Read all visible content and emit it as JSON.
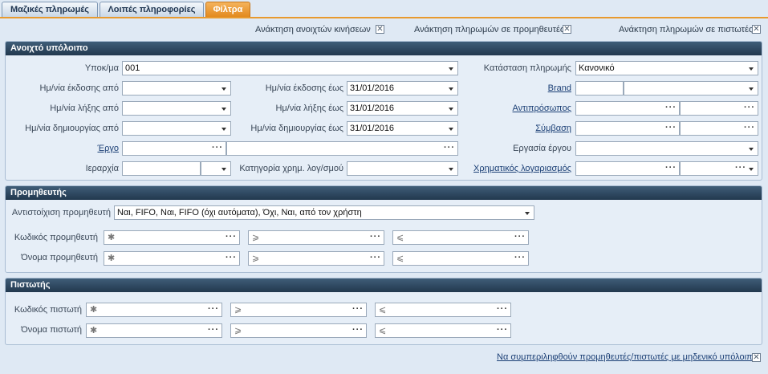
{
  "tabs": [
    {
      "label": "Μαζικές πληρωμές"
    },
    {
      "label": "Λοιπές πληροφορίες"
    },
    {
      "label": "Φίλτρα"
    }
  ],
  "top_options": [
    {
      "label": "Ανάκτηση ανοιχτών κινήσεων",
      "checked": "✕"
    },
    {
      "label": "Ανάκτηση πληρωμών σε προμηθευτές",
      "checked": "✕"
    },
    {
      "label": "Ανάκτηση πληρωμών σε πιστωτές",
      "checked": "✕"
    }
  ],
  "open_balance": {
    "title": "Ανοιχτό υπόλοιπο",
    "subsidiary_label": "Υποκ/μα",
    "subsidiary_value": "001",
    "issue_from_label": "Ημ/νία έκδοσης από",
    "issue_from_value": "",
    "issue_to_label": "Ημ/νία έκδοσης έως",
    "issue_to_value": "31/01/2016",
    "due_from_label": "Ημ/νία λήξης από",
    "due_from_value": "",
    "due_to_label": "Ημ/νία λήξης έως",
    "due_to_value": "31/01/2016",
    "created_from_label": "Ημ/νία δημιουργίας από",
    "created_from_value": "",
    "created_to_label": "Ημ/νία δημιουργίας έως",
    "created_to_value": "31/01/2016",
    "project_label": "Έργο",
    "hierarchy_label": "Ιεραρχία",
    "fin_category_label": "Κατηγορία χρημ. λογ/σμού",
    "payment_status_label": "Κατάσταση πληρωμής",
    "payment_status_value": "Κανονικό",
    "brand_label": "Brand",
    "representative_label": "Αντιπρόσωπος",
    "contract_label": "Σύμβαση",
    "project_task_label": "Εργασία έργου",
    "fin_account_label": "Χρηματικός λογαριασμός",
    "dots": "···"
  },
  "supplier": {
    "title": "Προμηθευτής",
    "matching_label": "Αντιστοίχιση προμηθευτή",
    "matching_value": "Ναι, FIFO, Ναι, FIFO (όχι αυτόματα), Όχι, Ναι, από τον χρήστη",
    "code_label": "Κωδικός προμηθευτή",
    "name_label": "Όνομα προμηθευτή"
  },
  "creditor": {
    "title": "Πιστωτής",
    "code_label": "Κωδικός πιστωτή",
    "name_label": "Όνομα πιστωτή"
  },
  "ops": {
    "wildcard": "✱",
    "gte": "⩾",
    "lte": "⩽"
  },
  "footer": {
    "include_zero_label": "Να συμπεριληφθούν προμηθευτές/πιστωτές με μηδενικό υπόλοιπο",
    "checked": "✕"
  }
}
